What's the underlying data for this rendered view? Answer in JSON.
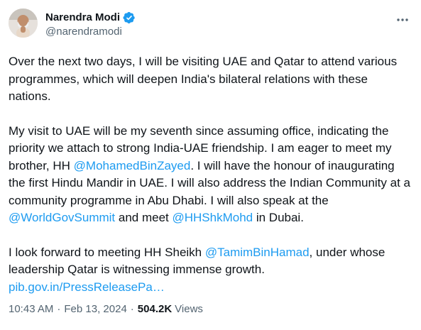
{
  "author": {
    "display_name": "Narendra Modi",
    "handle": "@narendramodi",
    "verified_color": "#1d9bf0"
  },
  "tweet": {
    "p1": "Over the next two days, I will be visiting UAE and Qatar to attend various programmes, which will deepen India's bilateral relations with these nations.",
    "p2": {
      "t1": "My visit to UAE will be my seventh since assuming office, indicating the priority we attach to strong India-UAE friendship. I am eager to meet my brother, HH ",
      "m1": "@MohamedBinZayed",
      "t2": ". I will have the honour of inaugurating the first Hindu Mandir in UAE. I will also address the Indian Community at a community programme in Abu Dhabi. I will also speak at the ",
      "m2": "@WorldGovSummit",
      "t3": " and meet ",
      "m3": "@HHShkMohd",
      "t4": " in Dubai."
    },
    "p3": {
      "t1": "I look forward to meeting HH Sheikh ",
      "m1": "@TamimBinHamad",
      "t2": ", under whose leadership Qatar is witnessing immense growth.",
      "link": "pib.gov.in/PressReleasePa…"
    }
  },
  "meta": {
    "time": "10:43 AM",
    "separator": "·",
    "date": "Feb 13, 2024",
    "views_count": "504.2K",
    "views_label": "Views"
  },
  "icons": {
    "verified": "verified-badge-icon",
    "more": "more-options-icon"
  },
  "colors": {
    "text": "#0f1419",
    "secondary": "#536471",
    "accent": "#1d9bf0"
  }
}
